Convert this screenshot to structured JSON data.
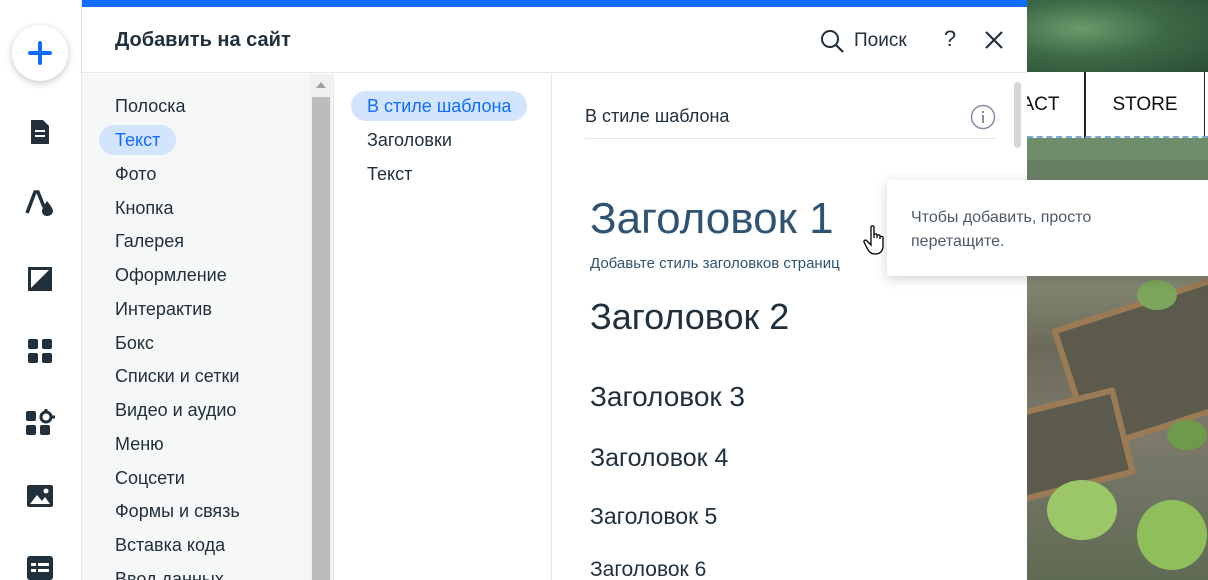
{
  "panel": {
    "title": "Добавить на сайт",
    "search_label": "Поиск",
    "help_label": "?"
  },
  "categories": [
    {
      "label": "Полоска",
      "active": false
    },
    {
      "label": "Текст",
      "active": true
    },
    {
      "label": "Фото",
      "active": false
    },
    {
      "label": "Кнопка",
      "active": false
    },
    {
      "label": "Галерея",
      "active": false
    },
    {
      "label": "Оформление",
      "active": false
    },
    {
      "label": "Интерактив",
      "active": false
    },
    {
      "label": "Бокс",
      "active": false
    },
    {
      "label": "Списки и сетки",
      "active": false
    },
    {
      "label": "Видео и аудио",
      "active": false
    },
    {
      "label": "Меню",
      "active": false
    },
    {
      "label": "Соцсети",
      "active": false
    },
    {
      "label": "Формы и связь",
      "active": false
    },
    {
      "label": "Вставка кода",
      "active": false
    },
    {
      "label": "Ввод данных",
      "active": false
    }
  ],
  "subcategories": [
    {
      "label": "В стиле шаблона",
      "active": true
    },
    {
      "label": "Заголовки",
      "active": false
    },
    {
      "label": "Текст",
      "active": false
    }
  ],
  "content": {
    "section_title": "В стиле шаблона",
    "heading1": "Заголовок 1",
    "heading1_hint": "Добавьте стиль заголовков страниц",
    "heading2": "Заголовок 2",
    "heading3": "Заголовок 3",
    "heading4": "Заголовок 4",
    "heading5": "Заголовок 5",
    "heading6": "Заголовок 6"
  },
  "tooltip": {
    "text": "Чтобы добавить, просто перетащите."
  },
  "site_preview": {
    "nav_items": [
      "ACT",
      "STORE"
    ]
  },
  "colors": {
    "accent": "#116dff",
    "active_bg": "#d3e4fd",
    "heading1": "#2f5473"
  },
  "icons": {
    "rail": [
      "add-icon",
      "pages-icon",
      "design-icon",
      "background-icon",
      "apps-icon",
      "business-icon",
      "media-icon",
      "cms-icon"
    ]
  }
}
